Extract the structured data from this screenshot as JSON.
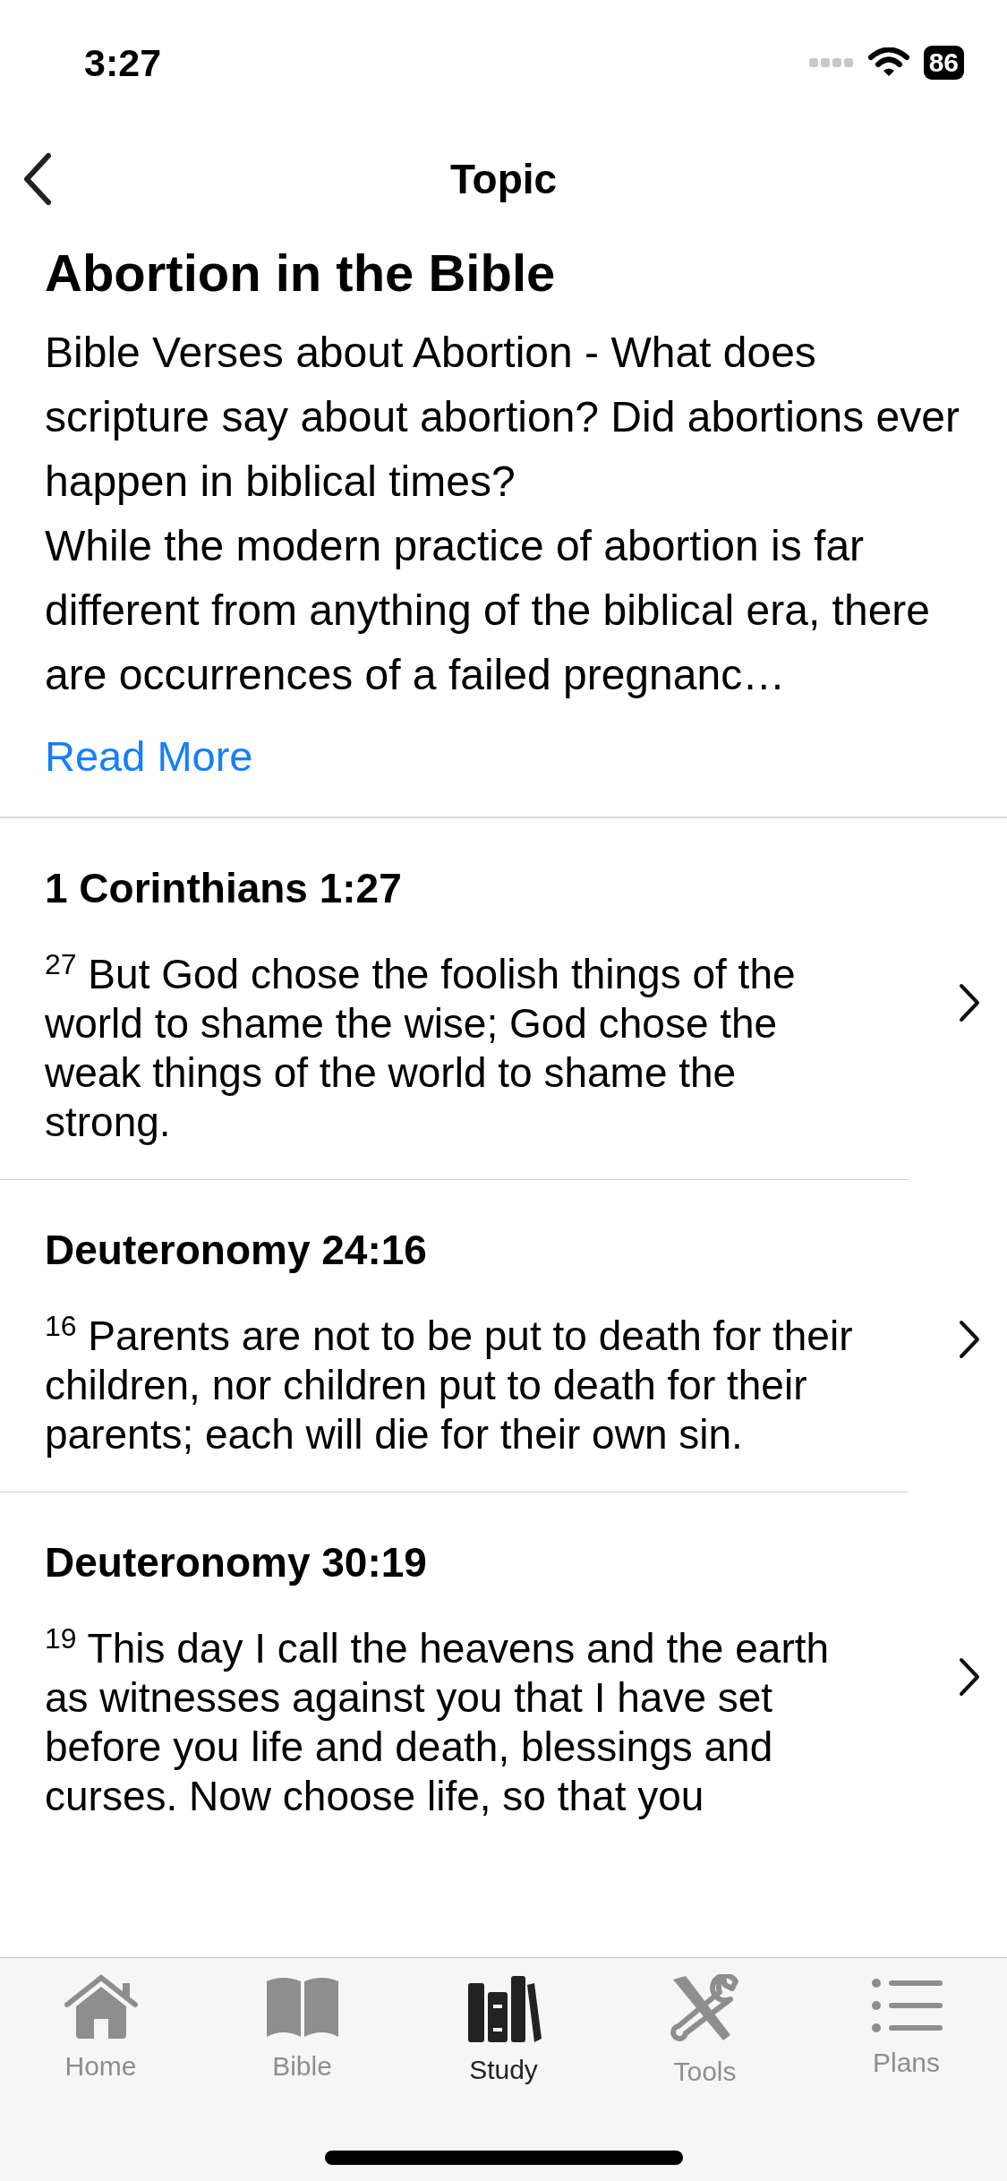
{
  "status_bar": {
    "time": "3:27",
    "battery": "86"
  },
  "nav": {
    "title": "Topic"
  },
  "topic": {
    "title": "Abortion in the Bible",
    "paragraphs": [
      "Bible Verses about Abortion - What does scripture say about abortion? Did abortions ever happen in biblical times?",
      "While the modern practice of abortion is far different from anything of the biblical era, there are occurrences of a failed pregnanc…"
    ],
    "read_more": "Read More"
  },
  "verses": [
    {
      "reference": "1 Corinthians 1:27",
      "text": "$^{27}$ But God chose the foolish things of the world to shame the wise; God chose the weak things of the world to shame the strong."
    },
    {
      "reference": "Deuteronomy 24:16",
      "text": "$^{16}$ Parents are not to be put to death for their children, nor children put to death for their parents; each will die for their own sin."
    },
    {
      "reference": "Deuteronomy 30:19",
      "text": "$^{19}$ This day I call the heavens and the earth as witnesses against you that I have set before you life and death, blessings and curses. Now choose life, so that you"
    }
  ],
  "tabs": [
    {
      "kind": "home",
      "label": "Home",
      "selected": false
    },
    {
      "kind": "bible",
      "label": "Bible",
      "selected": false
    },
    {
      "kind": "study",
      "label": "Study",
      "selected": true
    },
    {
      "kind": "tools",
      "label": "Tools",
      "selected": false
    },
    {
      "kind": "plans",
      "label": "Plans",
      "selected": false
    }
  ]
}
